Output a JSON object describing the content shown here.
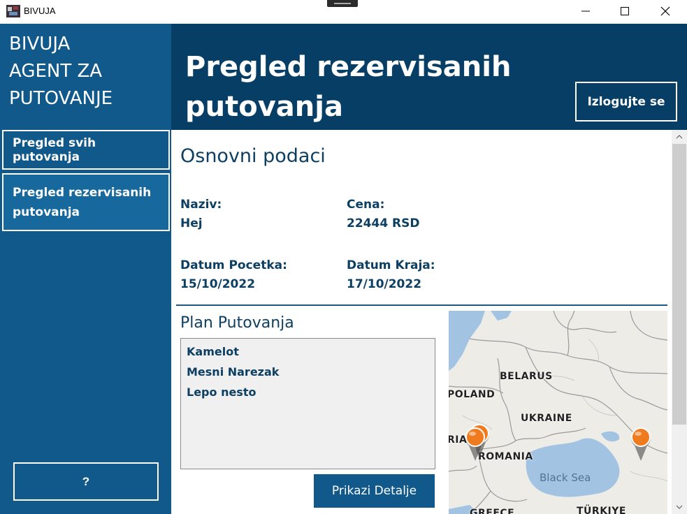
{
  "window": {
    "title": "BIVUJA",
    "minimize_label": "–",
    "maximize_label": "☐",
    "close_label": "✕"
  },
  "sidebar": {
    "brand_line1": "BIVUJA",
    "brand_line2": "AGENT ZA",
    "brand_line3": "PUTOVANJE",
    "items": [
      {
        "label": "Pregled svih putovanja"
      },
      {
        "label": "Pregled rezervisanih putovanja"
      }
    ],
    "help_label": "?"
  },
  "header": {
    "title": "Pregled rezervisanih putovanja",
    "logout_label": "Izlogujte se"
  },
  "main": {
    "section_title": "Osnovni podaci",
    "fields": {
      "name_label": "Naziv:",
      "name_value": "Hej",
      "price_label": "Cena:",
      "price_value": "22444 RSD",
      "start_label": "Datum Pocetka:",
      "start_value": "15/10/2022",
      "end_label": "Datum Kraja:",
      "end_value": "17/10/2022"
    },
    "plan": {
      "title": "Plan Putovanja",
      "items": [
        "Kamelot",
        "Mesni Narezak",
        "Lepo nesto"
      ]
    },
    "details_button": "Prikazi Detalje"
  },
  "map": {
    "labels": {
      "belarus": "BELARUS",
      "poland": "POLAND",
      "ukraine": "UKRAINE",
      "romania": "ROMANIA",
      "ria": "RIA",
      "black_sea": "Black Sea",
      "greece": "GREECE",
      "turkiye": "TÜRKIYE"
    },
    "pin_color": "#f07a1e",
    "water_color": "#a3c3e2",
    "land_color": "#eeece6"
  },
  "colors": {
    "sidebar": "#11598a",
    "header": "#073e66",
    "text": "#0d3f63"
  }
}
